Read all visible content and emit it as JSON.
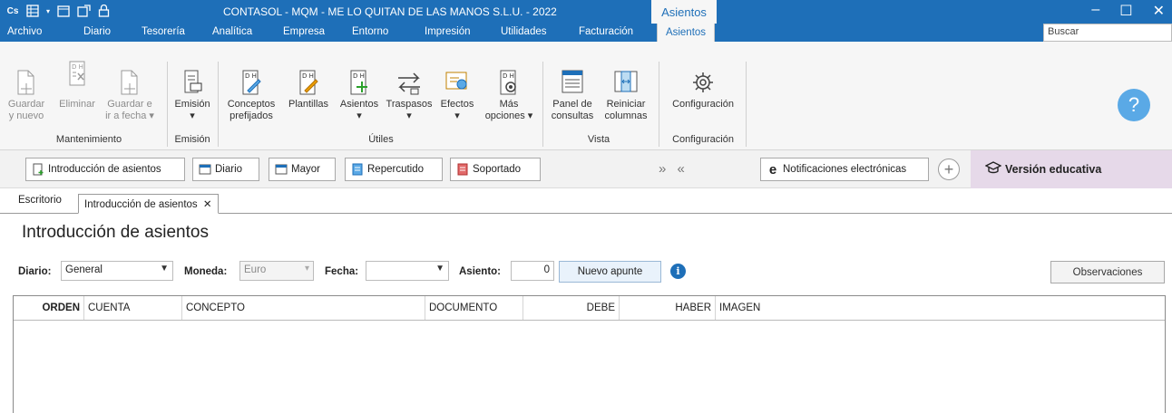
{
  "window": {
    "title": "CONTASOL - MQM - ME LO QUITAN DE LAS MANOS S.L.U. - 2022",
    "context_tab": "Asientos",
    "quick_access_logo": "Cs"
  },
  "menu": {
    "items": [
      "Archivo",
      "Diario",
      "Tesorería",
      "Analítica",
      "Empresa",
      "Entorno",
      "Impresión",
      "Utilidades",
      "Facturación"
    ],
    "active": "Asientos",
    "search_placeholder": "Buscar"
  },
  "ribbon": {
    "groups": {
      "mantenimiento": "Mantenimiento",
      "emision": "Emisión",
      "utiles": "Útiles",
      "vista": "Vista",
      "configuracion": "Configuración"
    },
    "buttons": {
      "guardar_nuevo_1": "Guardar",
      "guardar_nuevo_2": "y nuevo",
      "eliminar": "Eliminar",
      "guardar_ir_1": "Guardar e",
      "guardar_ir_2": "ir a fecha",
      "emision": "Emisión",
      "conceptos_1": "Conceptos",
      "conceptos_2": "prefijados",
      "plantillas": "Plantillas",
      "asientos": "Asientos",
      "traspasos": "Traspasos",
      "efectos": "Efectos",
      "mas_1": "Más",
      "mas_2": "opciones",
      "panel_1": "Panel de",
      "panel_2": "consultas",
      "reiniciar_1": "Reiniciar",
      "reiniciar_2": "columnas",
      "configuracion": "Configuración"
    }
  },
  "quickbar": {
    "introduccion": "Introducción de asientos",
    "diario": "Diario",
    "mayor": "Mayor",
    "repercutido": "Repercutido",
    "soportado": "Soportado",
    "arrows": "» «",
    "notificaciones": "Notificaciones electrónicas",
    "version": "Versión educativa"
  },
  "tabs": {
    "escritorio": "Escritorio",
    "active": "Introducción de asientos",
    "close": "✕"
  },
  "page": {
    "title": "Introducción de asientos"
  },
  "form": {
    "diario_label": "Diario:",
    "diario_value": "General",
    "moneda_label": "Moneda:",
    "moneda_value": "Euro",
    "fecha_label": "Fecha:",
    "fecha_value": "",
    "asiento_label": "Asiento:",
    "asiento_value": "0",
    "nuevo_apunte": "Nuevo apunte",
    "info": "i",
    "observaciones": "Observaciones"
  },
  "grid": {
    "columns": [
      "ORDEN",
      "CUENTA",
      "CONCEPTO",
      "DOCUMENTO",
      "DEBE",
      "HABER",
      "IMAGEN"
    ]
  },
  "colors": {
    "title_bar": "#1e6fb8",
    "ribbon_bg": "#f6f6f6",
    "edu_panel": "#e6d9e9",
    "help_circle": "#5aa9e6"
  }
}
